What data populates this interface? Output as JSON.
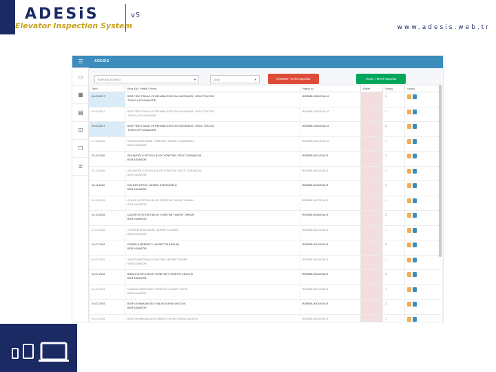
{
  "header": {
    "logo_text": "ADESiS",
    "logo_subtitle": "Elevator Inspection System",
    "version": "v5",
    "website": "www.adesis.web.tr"
  },
  "app": {
    "brand": "ADESİS",
    "filters": {
      "municipality": "BOR BELEDİYESİ",
      "year": "2016"
    },
    "buttons": {
      "red_report": "KIRMIZI / SARI Raporlar",
      "green_report": "YEŞİL / MAVİ Raporlar"
    },
    "columns": [
      "Tarih",
      "Bina Adı / Yetkili / Firma",
      "Rapor no",
      "Etiket",
      "Sonuç",
      "Sonuç"
    ],
    "rows": [
      {
        "date": "09-03-2017",
        "name": "BOR FİZİK TEDAVİ VE REHABİLİTASYON HASTANESİ / OĞUZ TOKGÖZ",
        "firm": "TEKNO-LİFT ASANSÖR",
        "report": "BORBEL0250/2016-01",
        "count": "1",
        "hl": true
      },
      {
        "date": "09-03-2017",
        "name": "BOR FİZİK TEDAVİ VE REHABİLİTASYON HASTANESİ / OĞUZ TOKGÖZ",
        "firm": "TEKNO-LİFT ASANSÖR",
        "report": "BORBEL0250/2016-02",
        "count": "1",
        "hl": false
      },
      {
        "date": "09-03-2017",
        "name": "BOR FİZİK TEDAVİ VE REHABİLİTASYON HASTANESİ / OĞUZ TOKGÖZ",
        "firm": "TEKNO-LİFT ASANSÖR",
        "report": "BORBEL0250/2016-01",
        "count": "1",
        "hl": true
      },
      {
        "date": "27-12-2016",
        "name": "KÖŞEM APARTMANI YÖNETİMİ / MURAT ÇOBANOĞLU",
        "firm": "BOR ASANSÖR",
        "report": "BORBEL0251/2016-01",
        "count": "1",
        "hl": false
      },
      {
        "date": "23-11-2016",
        "name": "SELAMOĞLU SİTESİ A BLOK YÖNETİMİ / SEVİT GÜRANCAN",
        "firm": "BOR ASANSÖR",
        "report": "BORBEL0001/2016-R",
        "count": "1",
        "hl": false
      },
      {
        "date": "23-11-2016",
        "name": "SELAMOĞLU SİTESİ B BLOK YÖNETİMİ / SEVİT GÜRANCAN",
        "firm": "BOR ASANSÖR",
        "report": "BORBEL0002/2016-R",
        "count": "1",
        "hl": false
      },
      {
        "date": "15-11-2016",
        "name": "KÜLTÜR SİTESİ / DAYBAY EFENDİOĞLU",
        "firm": "BOR ASANSÖR",
        "report": "BORBEL0003/2016-R",
        "count": "1",
        "hl": false
      },
      {
        "date": "20-10-2016",
        "name": "ÇUKUR İŞ SİTESİ A BLOK YÖNETİMİ / MURAT ORHAN",
        "firm": "BOR ASANSÖR",
        "report": "BORBEL0007/2016-R",
        "count": "1",
        "hl": false
      },
      {
        "date": "20-10-2016",
        "name": "ÇUKUR İŞ SİTESİ B BLOK YÖNETİMİ / MURAT ORHAN",
        "firm": "BOR ASANSÖR",
        "report": "BORBEL0008/2016-R",
        "count": "1",
        "hl": false
      },
      {
        "date": "07-07-2016",
        "name": "GÖRKEM APARTMANI / ŞÜKRÜ YILDIRIM",
        "firm": "BOR ASANSÖR",
        "report": "BORBEL0012/2016-R",
        "count": "1",
        "hl": false
      },
      {
        "date": "04-07-2016",
        "name": "DEMİR İŞ MERKEZİ / HAYRETTİN ARSLAN",
        "firm": "BOR ASANSÖR",
        "report": "BORBEL0014/2016-R",
        "count": "1",
        "hl": false
      },
      {
        "date": "04-07-2016",
        "name": "YAVUZ APARTMANI YÖNETİMİ / MEHMET DEMİR",
        "firm": "BOR ASANSÖR",
        "report": "BORBEL0015/2016-R",
        "count": "1",
        "hl": false
      },
      {
        "date": "04-07-2016",
        "name": "BİZİM EVLER D BLOK YÖNETİMİ / HÜSEYİN ÇEÇELİK",
        "firm": "BOR ASANSÖR",
        "report": "BORBEL0016/2016-R",
        "count": "1",
        "hl": false
      },
      {
        "date": "04-07-2016",
        "name": "NURDAN APARTMANI YÖNETİMİ / AHMET YILDIZ",
        "firm": "BOR ASANSÖR",
        "report": "BORBEL0017/2016-R",
        "count": "1",
        "hl": false
      },
      {
        "date": "04-07-2016",
        "name": "BOR KAYMAKAMLIĞI / HALAN DURAK AKCELİK",
        "firm": "BOR ASANSÖR",
        "report": "BORBEL0018/2016-R",
        "count": "1",
        "hl": false
      },
      {
        "date": "04-07-2016",
        "name": "BOR KAYMAKAMLIĞI LOJMANI / HALAN DURAK AKCELİK",
        "firm": "BOR ASANSÖR",
        "report": "BORBEL0019/2016-R",
        "count": "1",
        "hl": false
      }
    ]
  },
  "colors": {
    "brand_navy": "#1b2a63",
    "topbar_blue": "#3c8dbc",
    "red_button": "#dd4b39",
    "green_button": "#00a65a",
    "label_pink": "#f2dede"
  }
}
